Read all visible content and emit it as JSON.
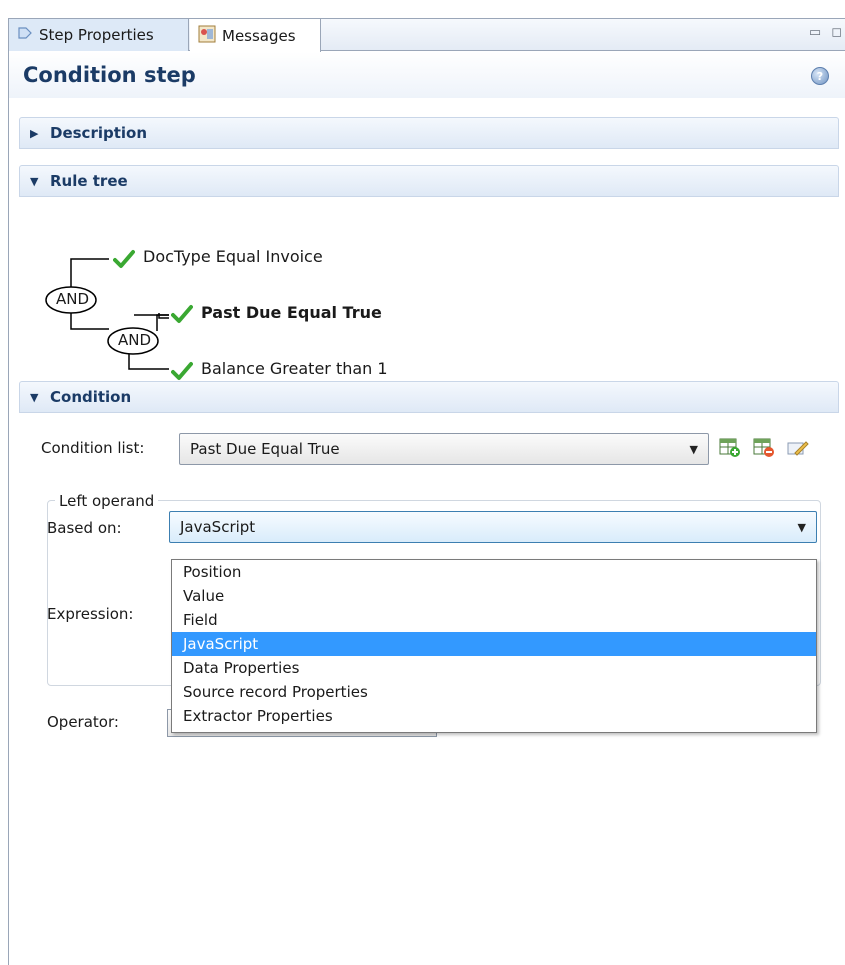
{
  "tabs": [
    {
      "label": "Step Properties",
      "icon": "step-properties-icon",
      "active": true
    },
    {
      "label": "Messages",
      "icon": "messages-icon",
      "active": false
    }
  ],
  "header": {
    "title": "Condition step"
  },
  "sections": {
    "description": "Description",
    "rule_tree": "Rule tree",
    "condition": "Condition"
  },
  "rule_tree": {
    "operators": [
      "AND",
      "AND"
    ],
    "rules": [
      {
        "text": "DocType Equal Invoice",
        "bold": false
      },
      {
        "text": "Past Due Equal True",
        "bold": true
      },
      {
        "text": "Balance Greater than 1",
        "bold": false
      }
    ]
  },
  "condition": {
    "condition_list_label": "Condition list:",
    "condition_list_value": "Past Due Equal True",
    "left_operand_title": "Left operand",
    "based_on_label": "Based on:",
    "based_on_value": "JavaScript",
    "expression_label": "Expression:",
    "operator_label": "Operator:",
    "based_on_options": [
      "Position",
      "Value",
      "Field",
      "JavaScript",
      "Data Properties",
      "Source record Properties",
      "Extractor Properties"
    ],
    "selected_option": "JavaScript"
  },
  "colors": {
    "title": "#1b3b66",
    "selection": "#3399ff",
    "check": "#3aa832"
  }
}
